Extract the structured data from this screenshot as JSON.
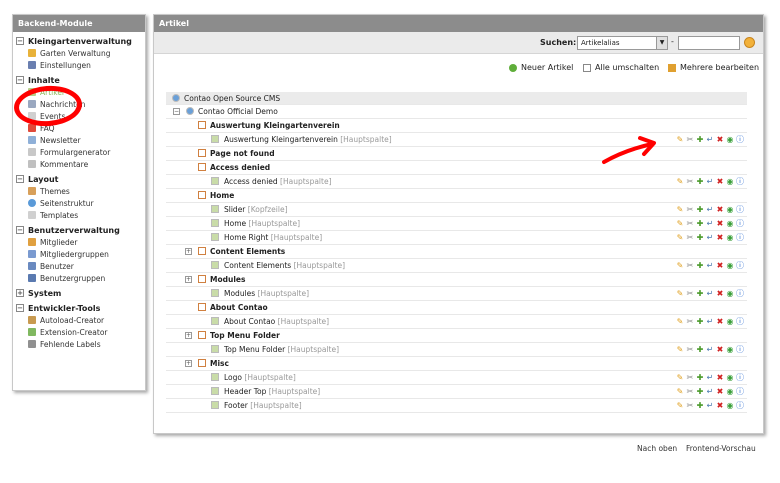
{
  "sidebar": {
    "title": "Backend-Module",
    "groups": [
      {
        "label": "Kleingartenverwaltung",
        "items": [
          "Garten Verwaltung",
          "Einstellungen"
        ]
      },
      {
        "label": "Inhalte",
        "items": [
          "Artikel",
          "Nachrichten",
          "Events",
          "FAQ",
          "Newsletter",
          "Formulargenerator",
          "Kommentare"
        ]
      },
      {
        "label": "Layout",
        "items": [
          "Themes",
          "Seitenstruktur",
          "Templates"
        ]
      },
      {
        "label": "Benutzerverwaltung",
        "items": [
          "Mitglieder",
          "Mitgliedergruppen",
          "Benutzer",
          "Benutzergruppen"
        ]
      },
      {
        "label": "System",
        "items": []
      },
      {
        "label": "Entwickler-Tools",
        "items": [
          "Autoload-Creator",
          "Extension-Creator",
          "Fehlende Labels"
        ]
      }
    ]
  },
  "main": {
    "title": "Artikel",
    "search_label": "Suchen:",
    "search_field": "Artikelalias",
    "search_dash": "-",
    "actions": {
      "new": "Neuer Artikel",
      "toggle": "Alle umschalten",
      "edit_multiple": "Mehrere bearbeiten"
    },
    "tree": [
      {
        "kind": "root",
        "label": "Contao Open Source CMS"
      },
      {
        "kind": "site",
        "label": "Contao Official Demo"
      },
      {
        "kind": "page",
        "label": "Auswertung Kleingartenverein"
      },
      {
        "kind": "article",
        "label": "Auswertung Kleingartenverein",
        "section": "[Hauptspalte]"
      },
      {
        "kind": "page",
        "label": "Page not found"
      },
      {
        "kind": "page",
        "label": "Access denied"
      },
      {
        "kind": "article",
        "label": "Access denied",
        "section": "[Hauptspalte]"
      },
      {
        "kind": "page",
        "label": "Home"
      },
      {
        "kind": "article",
        "label": "Slider",
        "section": "[Kopfzeile]"
      },
      {
        "kind": "article",
        "label": "Home",
        "section": "[Hauptspalte]"
      },
      {
        "kind": "article",
        "label": "Home Right",
        "section": "[Hauptspalte]"
      },
      {
        "kind": "page",
        "label": "Content Elements",
        "expand": true
      },
      {
        "kind": "article",
        "label": "Content Elements",
        "section": "[Hauptspalte]"
      },
      {
        "kind": "page",
        "label": "Modules",
        "expand": true
      },
      {
        "kind": "article",
        "label": "Modules",
        "section": "[Hauptspalte]"
      },
      {
        "kind": "page",
        "label": "About Contao"
      },
      {
        "kind": "article",
        "label": "About Contao",
        "section": "[Hauptspalte]"
      },
      {
        "kind": "page",
        "label": "Top Menu Folder",
        "expand": true
      },
      {
        "kind": "article",
        "label": "Top Menu Folder",
        "section": "[Hauptspalte]"
      },
      {
        "kind": "page",
        "label": "Misc",
        "expand": true
      },
      {
        "kind": "article",
        "label": "Logo",
        "section": "[Hauptspalte]"
      },
      {
        "kind": "article",
        "label": "Header Top",
        "section": "[Hauptspalte]"
      },
      {
        "kind": "article",
        "label": "Footer",
        "section": "[Hauptspalte]"
      }
    ],
    "op_icons": [
      "edit-icon",
      "edit-header-icon",
      "copy-icon",
      "move-icon",
      "delete-icon",
      "toggle-visibility-icon",
      "info-icon"
    ]
  },
  "footer": {
    "back_to_top": "Nach oben",
    "frontend_preview": "Frontend-Vorschau"
  },
  "colors": {
    "header_bar": "#8c8c8c",
    "active_link": "#8ab858",
    "annotation": "#ff0000"
  }
}
